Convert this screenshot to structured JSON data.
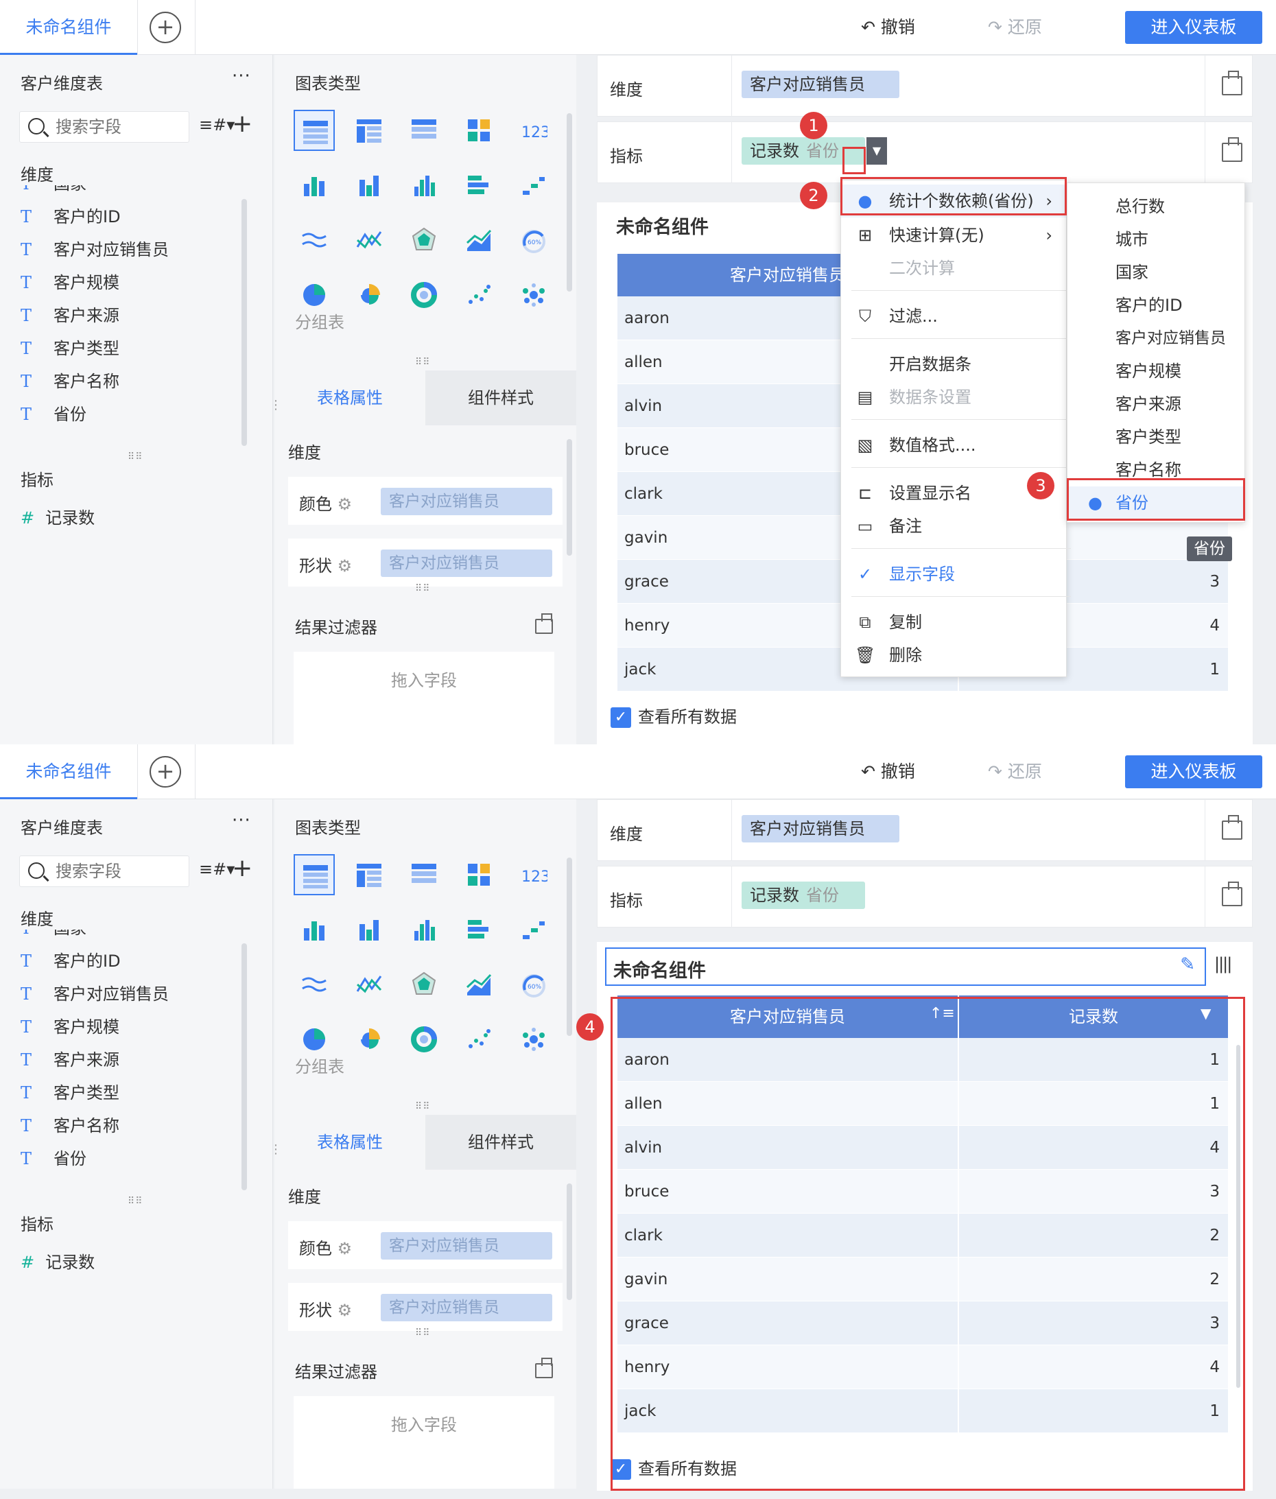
{
  "topbar": {
    "tab_name": "未命名组件",
    "undo": "撤销",
    "redo": "还原",
    "enter": "进入仪表板"
  },
  "left": {
    "table_name": "客户维度表",
    "more": "···",
    "search_placeholder": "搜索字段",
    "dim_label": "维度",
    "fields": [
      {
        "t": "T",
        "name": "国家"
      },
      {
        "t": "T",
        "name": "客户的ID"
      },
      {
        "t": "T",
        "name": "客户对应销售员"
      },
      {
        "t": "T",
        "name": "客户规模"
      },
      {
        "t": "T",
        "name": "客户来源"
      },
      {
        "t": "T",
        "name": "客户类型"
      },
      {
        "t": "T",
        "name": "客户名称"
      },
      {
        "t": "T",
        "name": "省份"
      }
    ],
    "measure_label": "指标",
    "measure_icon": "#",
    "measure": "记录数"
  },
  "mid": {
    "chart_type_label": "图表类型",
    "group_table": "分组表",
    "tab_table_props": "表格属性",
    "tab_comp_style": "组件样式",
    "dim_label": "维度",
    "color_label": "颜色",
    "shape_label": "形状",
    "color_field": "客户对应销售员",
    "shape_field": "客户对应销售员",
    "result_filter": "结果过滤器",
    "drop_hint": "拖入字段"
  },
  "right": {
    "dim_shelf": "维度",
    "dim_chip": "客户对应销售员",
    "mea_shelf": "指标",
    "mea_chip": "记录数",
    "mea_chip_sub": "省份",
    "comp_title": "未命名组件",
    "col1": "客户对应销售员",
    "col2": "记录数",
    "check_all": "查看所有数据"
  },
  "s1_rows": [
    {
      "name": "aaron",
      "val": ""
    },
    {
      "name": "allen",
      "val": ""
    },
    {
      "name": "alvin",
      "val": ""
    },
    {
      "name": "bruce",
      "val": ""
    },
    {
      "name": "clark",
      "val": ""
    },
    {
      "name": "gavin",
      "val": ""
    },
    {
      "name": "grace",
      "val": "3"
    },
    {
      "name": "henry",
      "val": "4"
    },
    {
      "name": "jack",
      "val": "1"
    }
  ],
  "s2_rows": [
    {
      "name": "aaron",
      "val": "1"
    },
    {
      "name": "allen",
      "val": "1"
    },
    {
      "name": "alvin",
      "val": "4"
    },
    {
      "name": "bruce",
      "val": "3"
    },
    {
      "name": "clark",
      "val": "2"
    },
    {
      "name": "gavin",
      "val": "2"
    },
    {
      "name": "grace",
      "val": "3"
    },
    {
      "name": "henry",
      "val": "4"
    },
    {
      "name": "jack",
      "val": "1"
    }
  ],
  "menu": {
    "count_dep": "统计个数依赖(省份)",
    "quick_calc": "快速计算(无)",
    "second_calc": "二次计算",
    "filter": "过滤...",
    "databar_on": "开启数据条",
    "databar_set": "数据条设置",
    "num_format": "数值格式....",
    "set_display": "设置显示名",
    "remark": "备注",
    "show_field": "显示字段",
    "copy": "复制",
    "delete": "删除"
  },
  "submenu": [
    "总行数",
    "城市",
    "国家",
    "客户的ID",
    "客户对应销售员",
    "客户规模",
    "客户来源",
    "客户类型",
    "客户名称",
    "省份"
  ],
  "tooltip": "省份",
  "badges": [
    "1",
    "2",
    "3",
    "4"
  ],
  "colors": {
    "accent": "#3b7df0",
    "header": "#5b85d6",
    "annot": "#e03c3c"
  }
}
